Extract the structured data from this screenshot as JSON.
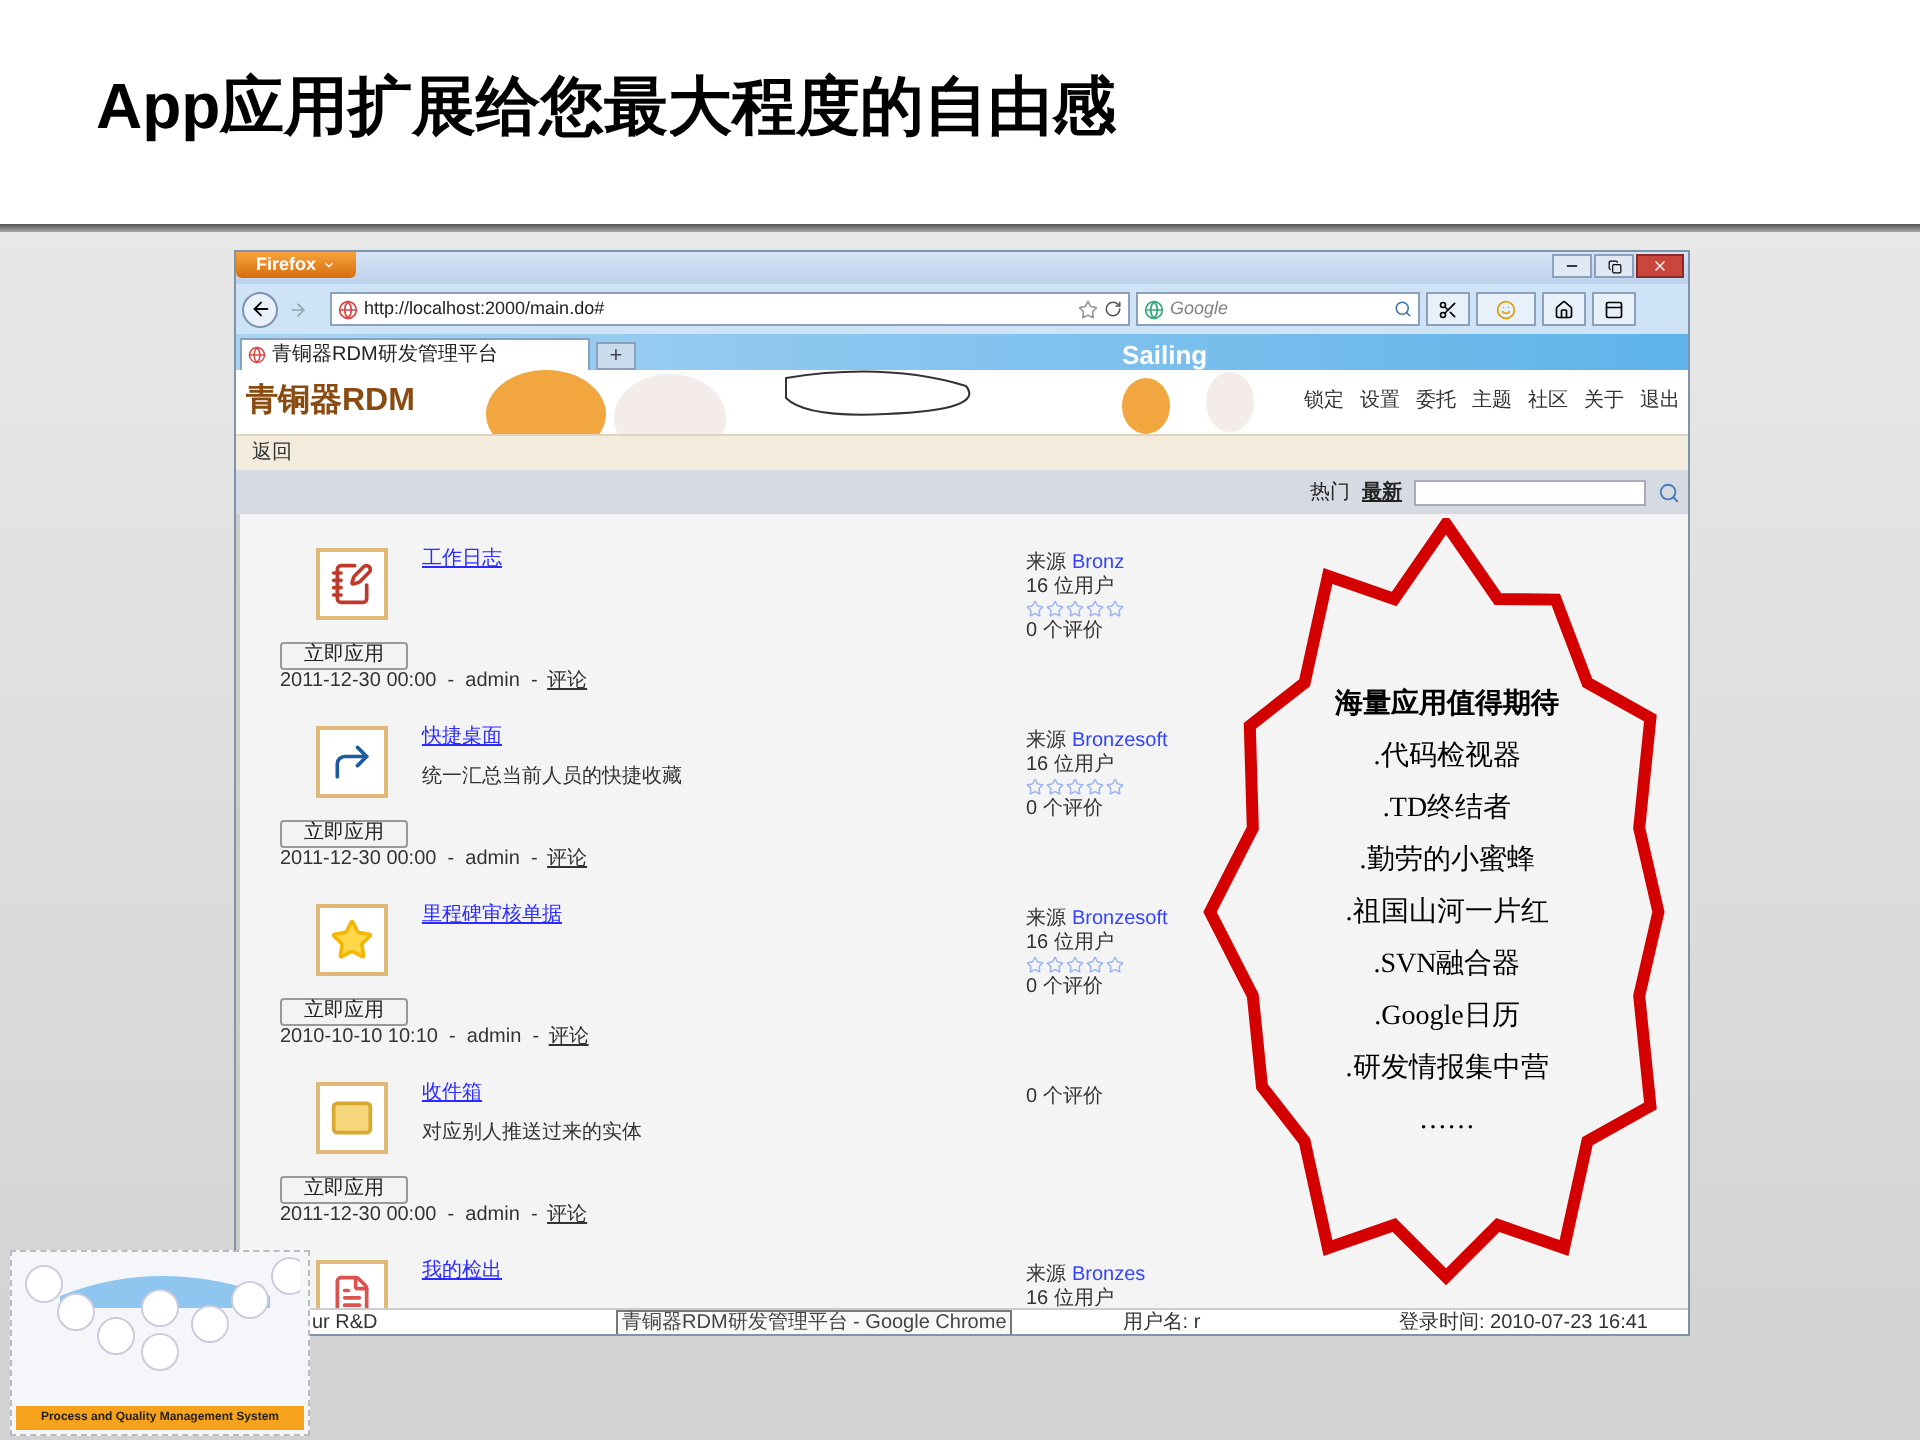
{
  "slide": {
    "title": "App应用扩展给您最大程度的自由感"
  },
  "browser": {
    "app_button": "Firefox",
    "url": "http://localhost:2000/main.do#",
    "search_placeholder": "Google",
    "tab": {
      "title": "青铜器RDM研发管理平台",
      "selected": true
    },
    "new_tab": "+",
    "theme_text": "Sailing"
  },
  "header": {
    "logo": "青铜器RDM",
    "menu": [
      "锁定",
      "设置",
      "委托",
      "主题",
      "社区",
      "关于",
      "退出"
    ]
  },
  "subbar": {
    "back": "返回"
  },
  "filter": {
    "tabs": [
      {
        "label": "热门",
        "selected": false
      },
      {
        "label": "最新",
        "selected": true
      }
    ]
  },
  "apps": [
    {
      "kind": "journal",
      "title": "工作日志",
      "button": "立即应用",
      "byline": "2011-12-30 00:00  -  admin  - ",
      "comment": "评论",
      "source_label": "来源",
      "source": "Bronz",
      "users": "16 位用户",
      "stars": 0,
      "reviews": "0 个评价"
    },
    {
      "kind": "shortcut",
      "title": "快捷桌面",
      "description": "统一汇总当前人员的快捷收藏",
      "button": "立即应用",
      "byline": "2011-12-30 00:00  -  admin  - ",
      "comment": "评论",
      "source_label": "来源",
      "source": "Bronzesoft",
      "users": "16 位用户",
      "stars": 0,
      "reviews": "0 个评价"
    },
    {
      "kind": "star",
      "title": "里程碑审核单据",
      "button": "立即应用",
      "byline": "2010-10-10 10:10  -  admin  - ",
      "comment": "评论",
      "source_label": "来源",
      "source": "Bronzesoft",
      "users": "16 位用户",
      "stars": 0,
      "reviews": "0 个评价"
    },
    {
      "kind": "mail",
      "title": "收件箱",
      "description": "对应别人推送过来的实体",
      "button": "立即应用",
      "byline": "2011-12-30 00:00  -  admin  - ",
      "comment": "评论",
      "reviews": "0 个评价"
    },
    {
      "kind": "form",
      "title": "我的检出",
      "source_label": "来源",
      "source": "Bronzes",
      "users": "16 位用户"
    }
  ],
  "starburst": {
    "heading": "海量应用值得期待",
    "items": [
      ".代码检视器",
      ".TD终结者",
      ".勤劳的小蜜蜂",
      ".祖国山河一片红",
      ".SVN融合器",
      ".Google日历",
      ".研发情报集中营",
      "……"
    ]
  },
  "status_bar": {
    "left": "ur R&D",
    "tooltip": "青铜器RDM研发管理平台 - Google Chrome",
    "user": "用户名: r",
    "login_time": "登录时间: 2010-07-23 16:41"
  },
  "inset": {
    "caption": "Process and Quality  Management System"
  }
}
